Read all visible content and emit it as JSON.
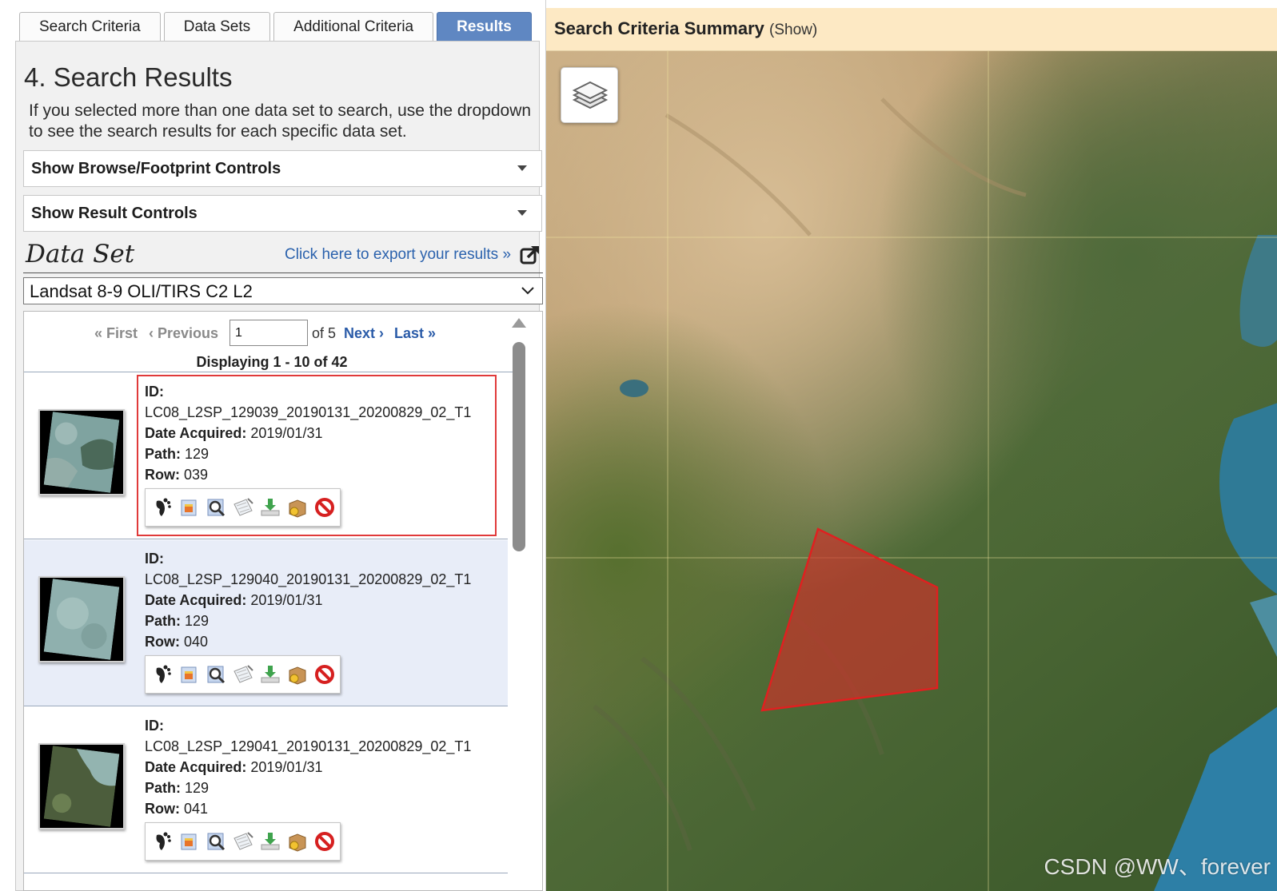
{
  "tabs": [
    {
      "label": "Search Criteria",
      "active": false
    },
    {
      "label": "Data Sets",
      "active": false
    },
    {
      "label": "Additional Criteria",
      "active": false
    },
    {
      "label": "Results",
      "active": true
    }
  ],
  "section": {
    "title": "4. Search Results",
    "intro": "If you selected more than one data set to search, use the dropdown to see the search results for each specific data set."
  },
  "accordions": {
    "browse_footprint": "Show Browse/Footprint Controls",
    "result_controls": "Show Result Controls"
  },
  "dataset": {
    "heading": "Data Set",
    "export_link": "Click here to export your results »",
    "selected": "Landsat 8-9 OLI/TIRS C2 L2"
  },
  "pager": {
    "first": "« First",
    "previous": "‹ Previous",
    "page": "1",
    "of": "of 5",
    "next": "Next ›",
    "last": "Last »",
    "displaying": "Displaying 1 - 10 of 42"
  },
  "labels": {
    "id": "ID:",
    "date": "Date Acquired:",
    "path": "Path:",
    "row": "Row:"
  },
  "results": [
    {
      "id": "LC08_L2SP_129039_20190131_20200829_02_T1",
      "date": "2019/01/31",
      "path": "129",
      "row": "039"
    },
    {
      "id": "LC08_L2SP_129040_20190131_20200829_02_T1",
      "date": "2019/01/31",
      "path": "129",
      "row": "040"
    },
    {
      "id": "LC08_L2SP_129041_20190131_20200829_02_T1",
      "date": "2019/01/31",
      "path": "129",
      "row": "041"
    }
  ],
  "toolbar_icons": [
    "footprint-icon",
    "overlay-icon",
    "metadata-icon",
    "compare-icon",
    "download-icon",
    "order-icon",
    "exclude-icon"
  ],
  "map": {
    "summary_title": "Search Criteria Summary",
    "summary_toggle": "(Show)",
    "watermark": "CSDN @WW、forever",
    "footprint_color": "#d0302a"
  },
  "colors": {
    "active_tab": "#5f87c2",
    "link": "#2a5ba8",
    "highlight": "#e03a3a",
    "summary_bar": "#fde9c4"
  }
}
